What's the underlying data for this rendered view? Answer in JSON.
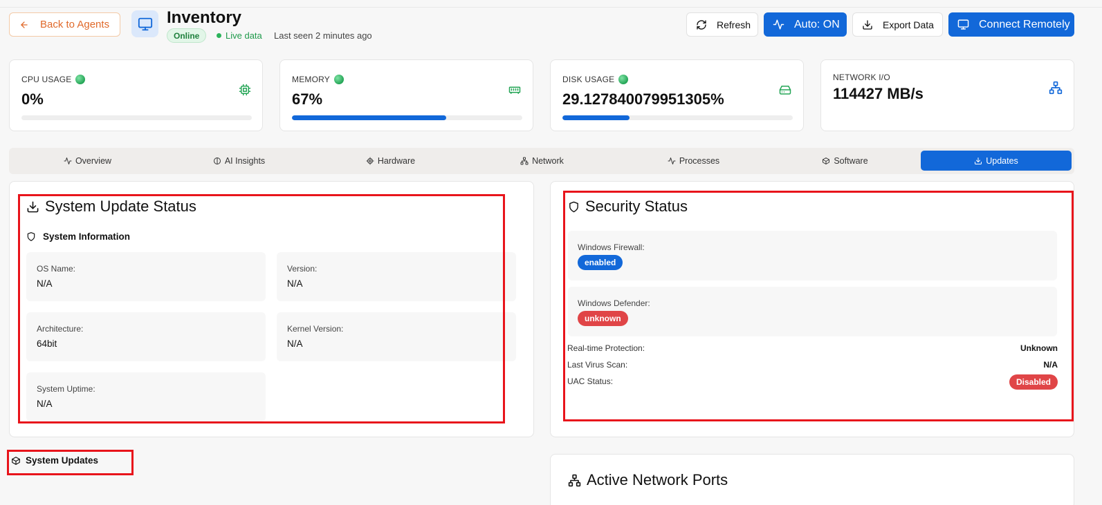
{
  "header": {
    "back_label": "Back to Agents",
    "title": "Inventory",
    "status_badge": "Online",
    "live_label": "Live data",
    "last_seen": "Last seen 2 minutes ago",
    "buttons": {
      "refresh": "Refresh",
      "auto": "Auto: ON",
      "export": "Export Data",
      "connect": "Connect Remotely"
    }
  },
  "stats": {
    "cpu": {
      "label": "CPU USAGE",
      "value": "0%",
      "percent": 0
    },
    "memory": {
      "label": "MEMORY",
      "value": "67%",
      "percent": 67
    },
    "disk": {
      "label": "DISK USAGE",
      "value": "29.127840079951305%",
      "percent": 29.13
    },
    "network": {
      "label": "NETWORK I/O",
      "value": "114427 MB/s"
    }
  },
  "tabs": [
    {
      "label": "Overview",
      "icon": "activity-icon"
    },
    {
      "label": "AI Insights",
      "icon": "brain-icon"
    },
    {
      "label": "Hardware",
      "icon": "cog-icon"
    },
    {
      "label": "Network",
      "icon": "network-icon"
    },
    {
      "label": "Processes",
      "icon": "activity-icon"
    },
    {
      "label": "Software",
      "icon": "package-icon"
    },
    {
      "label": "Updates",
      "icon": "download-icon",
      "active": true
    }
  ],
  "update_status": {
    "title": "System Update Status",
    "section": "System Information",
    "fields": {
      "os_name": {
        "key": "OS Name:",
        "value": "N/A"
      },
      "version": {
        "key": "Version:",
        "value": "N/A"
      },
      "architecture": {
        "key": "Architecture:",
        "value": "64bit"
      },
      "kernel": {
        "key": "Kernel Version:",
        "value": "N/A"
      },
      "uptime": {
        "key": "System Uptime:",
        "value": "N/A"
      }
    }
  },
  "security": {
    "title": "Security Status",
    "firewall": {
      "key": "Windows Firewall:",
      "value": "enabled"
    },
    "defender": {
      "key": "Windows Defender:",
      "value": "unknown"
    },
    "realtime": {
      "key": "Real-time Protection:",
      "value": "Unknown"
    },
    "last_scan": {
      "key": "Last Virus Scan:",
      "value": "N/A"
    },
    "uac": {
      "key": "UAC Status:",
      "value": "Disabled"
    }
  },
  "system_updates": {
    "title": "System Updates"
  },
  "ports": {
    "title": "Active Network Ports"
  },
  "colors": {
    "accent": "#1268d9",
    "success": "#24a556",
    "danger": "#e04547",
    "back": "#e0692a",
    "highlight": "#e8141b"
  }
}
